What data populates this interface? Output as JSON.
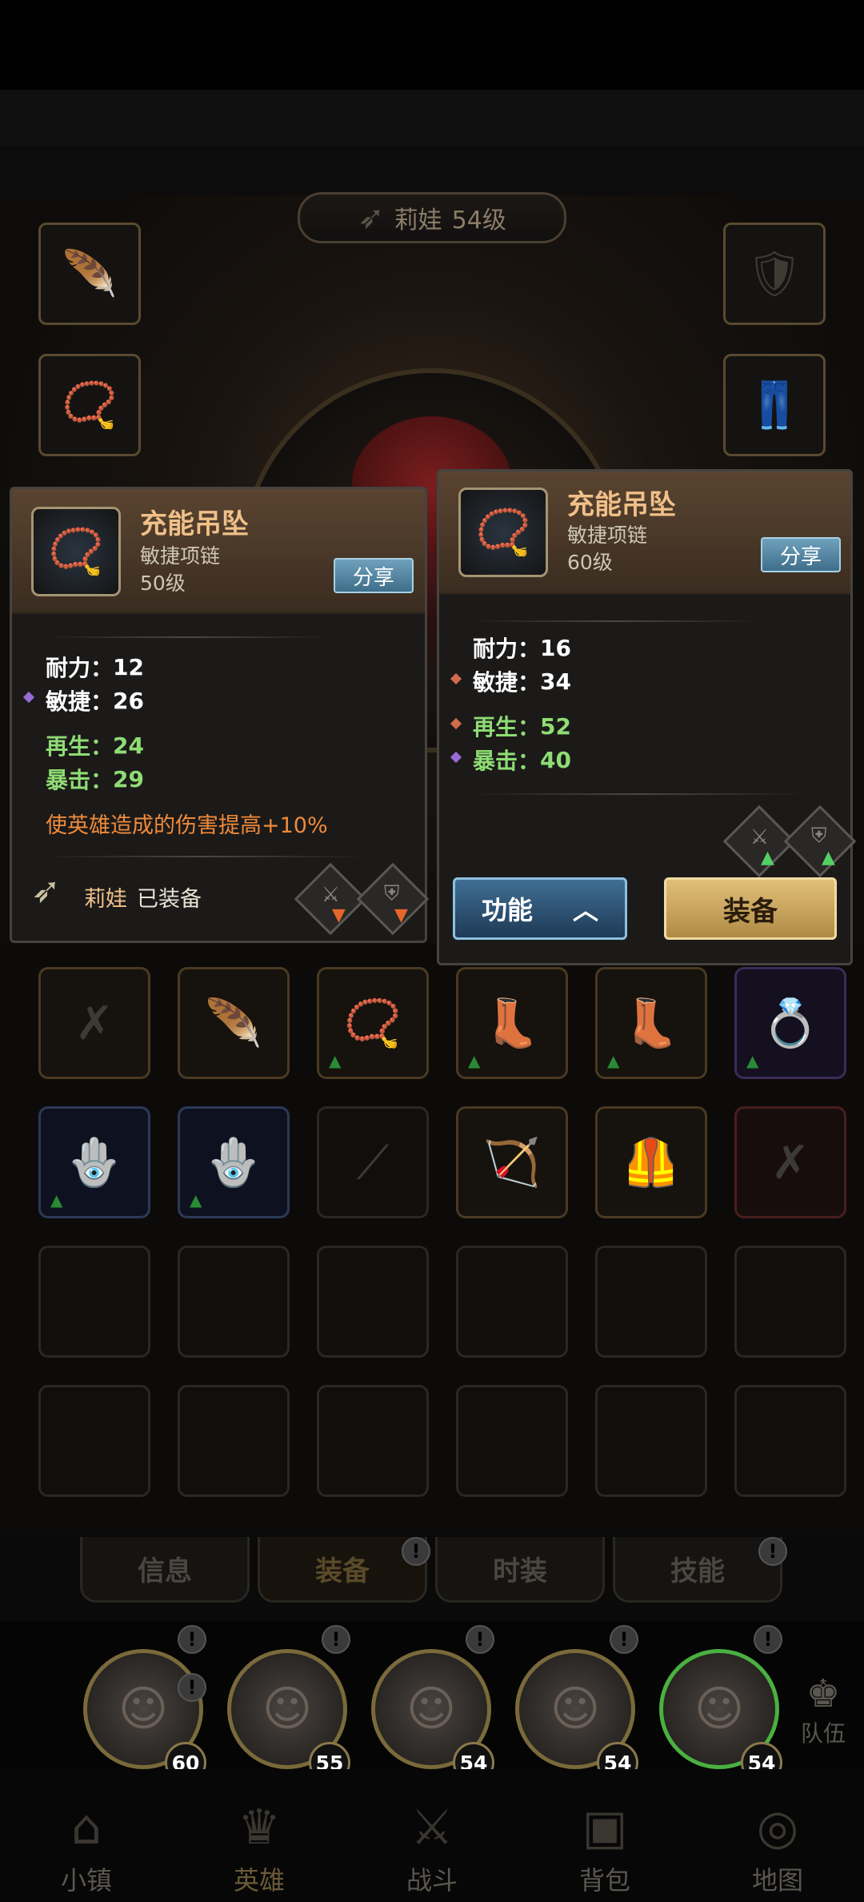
{
  "hero_header": {
    "name": "莉娃",
    "level": "54级"
  },
  "left_panel": {
    "name": "充能吊坠",
    "type": "敏捷项链",
    "level": "50级",
    "share": "分享",
    "stats": [
      {
        "label": "耐力",
        "sep": "：",
        "value": "12"
      },
      {
        "label": "敏捷",
        "sep": "：",
        "value": "26"
      },
      {
        "label": "再生",
        "sep": "：",
        "value": "24"
      },
      {
        "label": "暴击",
        "sep": "：",
        "value": "29"
      }
    ],
    "special": "使英雄造成的伤害提高+10%",
    "equipped_hero": "莉娃",
    "equipped_label": "已装备"
  },
  "right_panel": {
    "name": "充能吊坠",
    "type": "敏捷项链",
    "level": "60级",
    "share": "分享",
    "stats": [
      {
        "label": "耐力",
        "sep": "：",
        "value": "16"
      },
      {
        "label": "敏捷",
        "sep": "：",
        "value": "34"
      },
      {
        "label": "再生",
        "sep": "：",
        "value": "52"
      },
      {
        "label": "暴击",
        "sep": "：",
        "value": "40"
      }
    ],
    "function_button": "功能",
    "equip_button": "装备"
  },
  "tabs": [
    "信息",
    "装备",
    "时装",
    "技能"
  ],
  "tab_badge": "!",
  "heroes": [
    {
      "level": "60"
    },
    {
      "level": "55"
    },
    {
      "level": "54"
    },
    {
      "level": "54"
    },
    {
      "level": "54"
    }
  ],
  "team_label": "队伍",
  "nav": [
    "小镇",
    "英雄",
    "战斗",
    "背包",
    "地图"
  ],
  "colors": {
    "stat_green": "#8fdc74",
    "special_orange": "#ef8a3a",
    "item_name_gold": "#f0c089",
    "up_arrow": "#53d064",
    "down_arrow": "#e4662a"
  }
}
